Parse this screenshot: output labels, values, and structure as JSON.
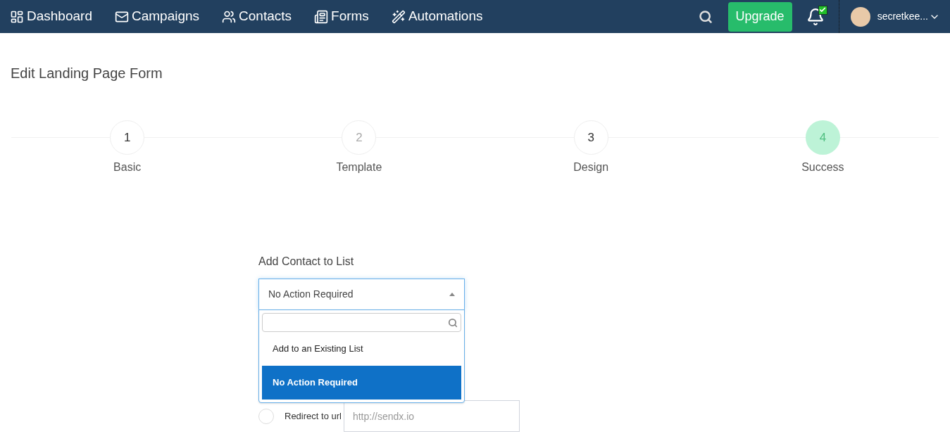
{
  "nav": {
    "items": [
      {
        "label": "Dashboard"
      },
      {
        "label": "Campaigns"
      },
      {
        "label": "Contacts"
      },
      {
        "label": "Forms"
      },
      {
        "label": "Automations"
      }
    ],
    "upgrade": "Upgrade",
    "notification_checked": true,
    "user": "secretkee..."
  },
  "page_title": "Edit Landing Page Form",
  "steps": [
    {
      "number": "1",
      "label": "Basic",
      "selected": false,
      "disabled": false
    },
    {
      "number": "2",
      "label": "Template",
      "selected": false,
      "disabled": true
    },
    {
      "number": "3",
      "label": "Design",
      "selected": false,
      "disabled": false
    },
    {
      "number": "4",
      "label": "Success",
      "selected": true,
      "disabled": false
    }
  ],
  "form": {
    "label": "Add Contact to List",
    "select_value": "No Action Required",
    "expanded": true,
    "options": [
      {
        "label": "Add to an Existing List",
        "selected": false
      },
      {
        "label": "No Action Required",
        "selected": true
      }
    ],
    "redirect": {
      "label": "Redirect to url",
      "checked": false,
      "placeholder": "http://sendx.io"
    }
  }
}
